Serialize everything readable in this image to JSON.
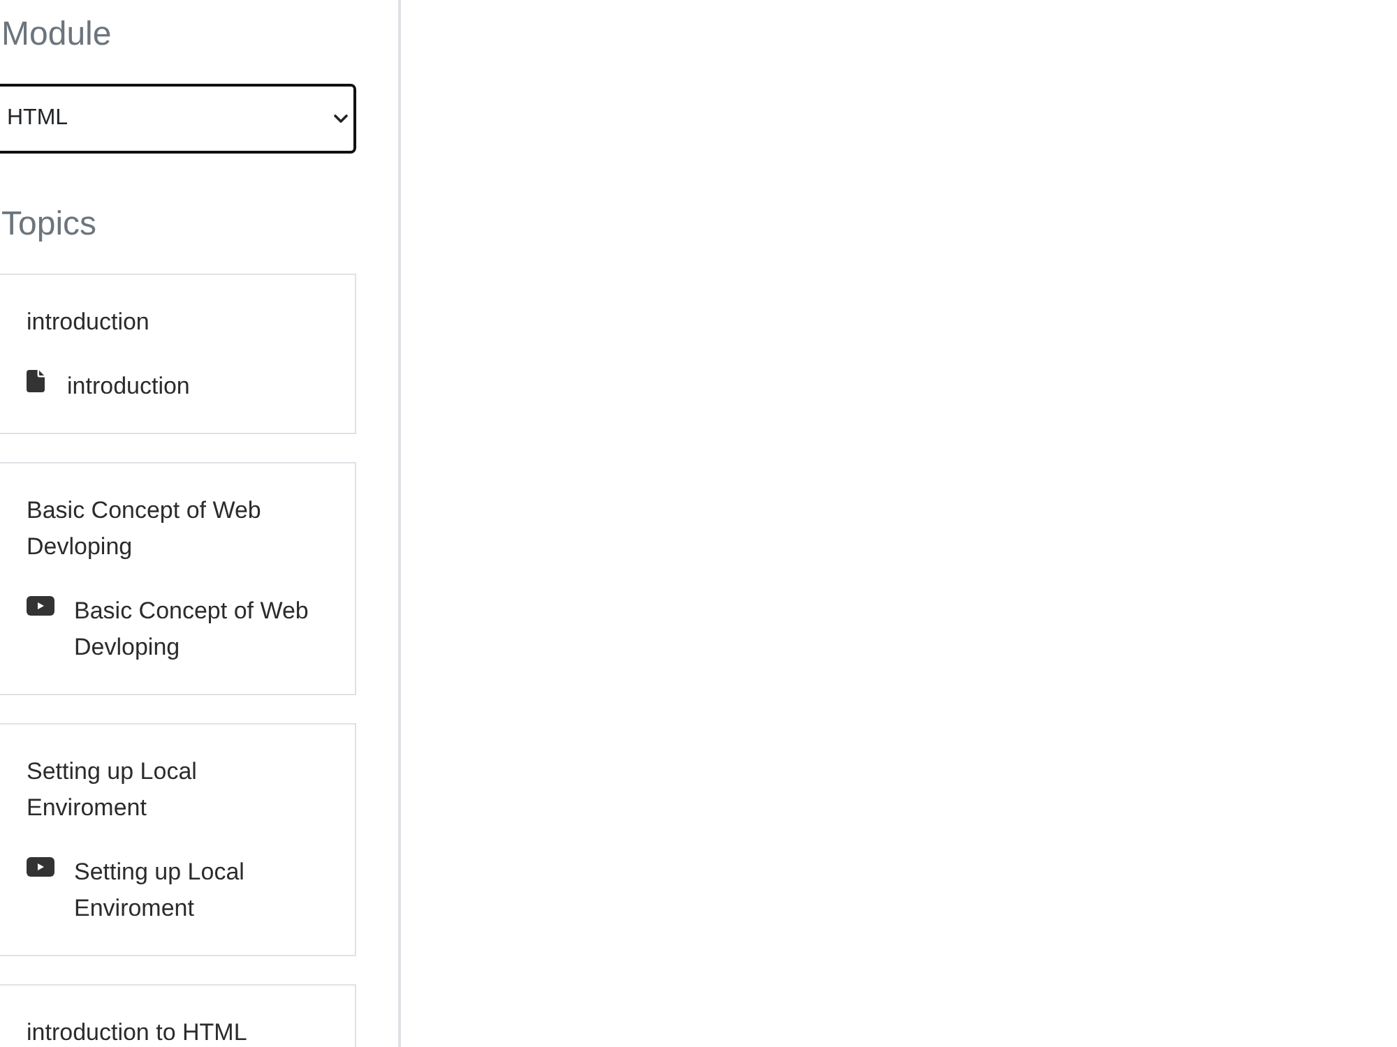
{
  "sidebar": {
    "module_heading": "Module",
    "module_select": {
      "value": "HTML"
    },
    "topics_heading": "Topics",
    "topics": [
      {
        "title": "introduction",
        "items": [
          {
            "kind": "document",
            "label": "introduction"
          }
        ]
      },
      {
        "title": "Basic Concept of Web Devloping",
        "items": [
          {
            "kind": "video",
            "label": "Basic Concept of Web Devloping"
          }
        ]
      },
      {
        "title": "Setting up Local Enviroment",
        "items": [
          {
            "kind": "video",
            "label": "Setting up Local Enviroment"
          }
        ]
      },
      {
        "title": "introduction to HTML"
      }
    ]
  }
}
